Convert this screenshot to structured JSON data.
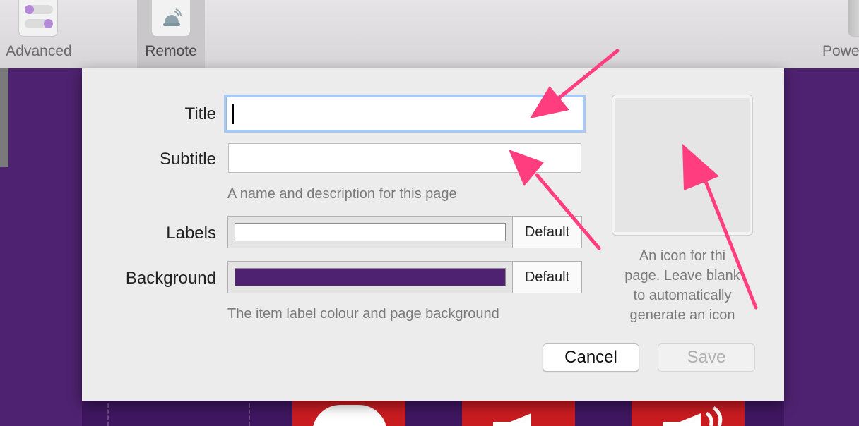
{
  "toolbar": {
    "items": [
      {
        "label": "Advanced",
        "icon": "toggle-switches-icon"
      },
      {
        "label": "Remote",
        "icon": "bell-icon",
        "selected": true
      },
      {
        "label": "Powe",
        "icon": "power-icon"
      }
    ]
  },
  "dialog": {
    "title_label": "Title",
    "title_value": "",
    "subtitle_label": "Subtitle",
    "subtitle_value": "",
    "name_hint": "A name and description for this page",
    "labels_label": "Labels",
    "labels_color": "#ffffff",
    "labels_default": "Default",
    "background_label": "Background",
    "background_color": "#4e2270",
    "background_default": "Default",
    "colour_hint": "The item label colour and page background",
    "icon_hint_lines": [
      "An icon for thi",
      "page. Leave blank",
      "to automatically",
      "generate an icon"
    ],
    "cancel_label": "Cancel",
    "save_label": "Save",
    "save_enabled": false
  },
  "colors": {
    "accent_focus": "#a9c9f3",
    "annotation_arrow": "#ff3d7f",
    "background_purple": "#4e2270",
    "tile_red": "#c91c20"
  }
}
